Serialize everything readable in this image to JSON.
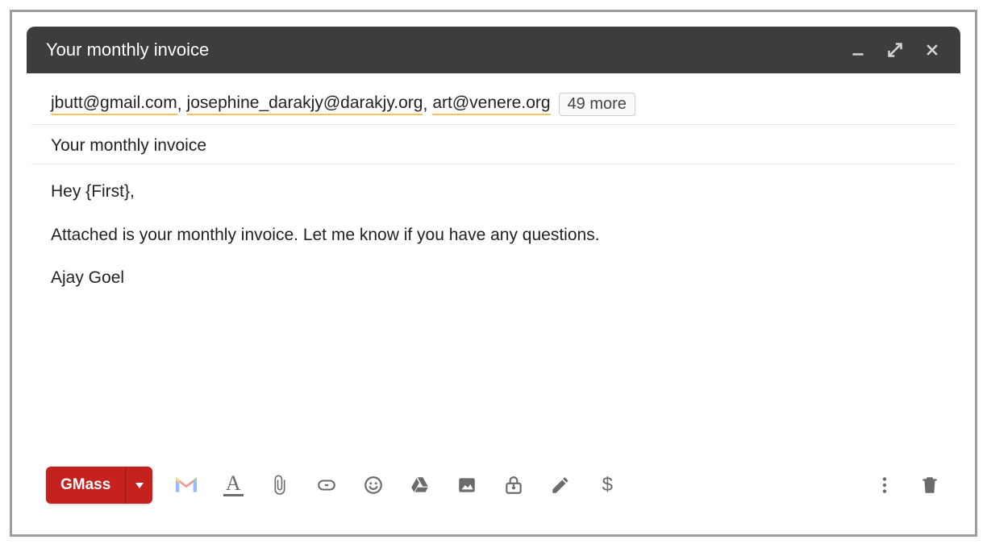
{
  "titlebar": {
    "title": "Your monthly invoice"
  },
  "recipients": {
    "list": [
      "jbutt@gmail.com",
      "josephine_darakjy@darakjy.org",
      "art@venere.org"
    ],
    "more_label": "49 more"
  },
  "subject": "Your monthly invoice",
  "body": {
    "greeting": "Hey {First},",
    "line1": "Attached is your monthly invoice. Let me know if you have any questions.",
    "signature": "Ajay Goel"
  },
  "toolbar": {
    "send_label": "GMass",
    "dollar": "$"
  }
}
